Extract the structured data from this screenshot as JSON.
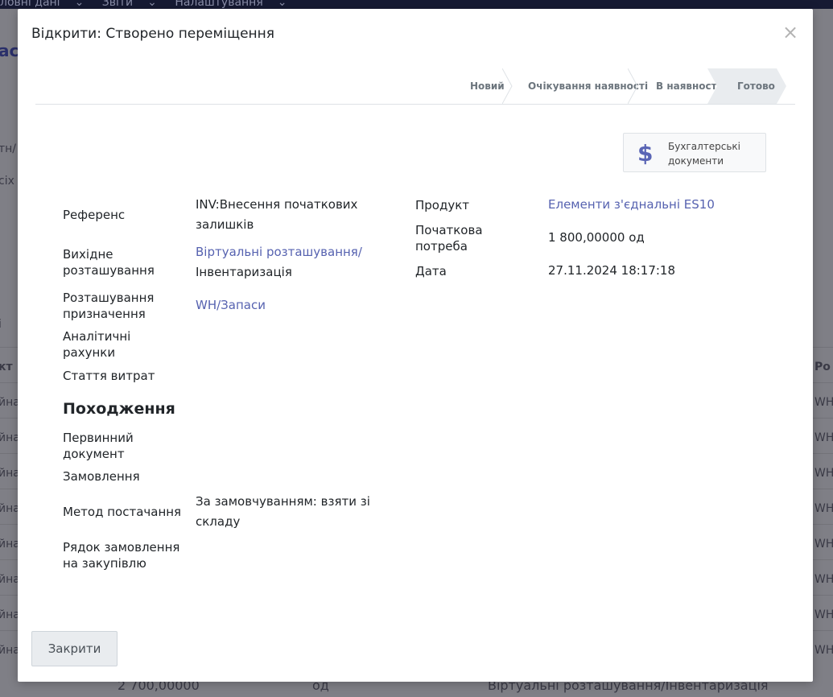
{
  "background": {
    "menu": [
      "ловні дані",
      "Звіти",
      "Налаштування"
    ],
    "left_fragments": [
      "ас",
      "тн/",
      "сіх",
      "і",
      "кт",
      "йна",
      "йна",
      "йна",
      "йна",
      "йна",
      "йна",
      "йна",
      "йна"
    ],
    "right_fragments": [
      "Ро",
      "WH/",
      "WH/",
      "WH/",
      "WH/",
      "WH/",
      "WH/",
      "WH/",
      "WH/"
    ],
    "footer": {
      "qty": "2 700,00000",
      "uom": "од",
      "location": "Віртуальні розташування/Інвентаризація"
    }
  },
  "modal": {
    "title": "Відкрити: Створено переміщення",
    "close_icon": "×"
  },
  "statusbar": {
    "steps": [
      "Новий",
      "Очікування наявності",
      "В наявності",
      "Готово"
    ],
    "active": "Готово"
  },
  "accounting_button": {
    "icon": "dollar-icon",
    "icon_glyph": "$",
    "label_line1": "Бухгалтерські",
    "label_line2": "документи"
  },
  "left_fields": {
    "reference": {
      "label": "Референс",
      "value_line1": "INV:Внесення початкових",
      "value_line2": "залишків"
    },
    "source_location": {
      "label_line1": "Вихідне",
      "label_line2": "розташування",
      "value_line1": "Віртуальні розташування/",
      "value_line2": "Інвентаризація"
    },
    "dest_location": {
      "label_line1": "Розташування",
      "label_line2": "призначення",
      "value": "WH/Запаси"
    },
    "analytic_accounts": {
      "label_line1": "Аналітичні",
      "label_line2": "рахунки"
    },
    "cost_item": {
      "label": "Стаття витрат"
    }
  },
  "right_fields": {
    "product": {
      "label": "Продукт",
      "value": "Елементи з'єднальні ES10"
    },
    "initial_demand": {
      "label_line1": "Початкова",
      "label_line2": "потреба",
      "value": "1 800,00000",
      "uom": "од"
    },
    "date": {
      "label": "Дата",
      "value": "27.11.2024 18:17:18"
    }
  },
  "origin": {
    "title": "Походження",
    "source_document": {
      "label_line1": "Первинний",
      "label_line2": "документ"
    },
    "order": {
      "label": "Замовлення"
    },
    "procure_method": {
      "label": "Метод постачання",
      "value_line1": "За замовчуванням: взяти зі",
      "value_line2": "складу"
    },
    "purchase_line": {
      "label_line1": "Рядок замовлення",
      "label_line2": "на закупівлю"
    }
  },
  "footer_button": {
    "label": "Закрити"
  },
  "colors": {
    "link": "#5662b0",
    "navbar": "#161a33",
    "active_step": "#e9ecef"
  }
}
